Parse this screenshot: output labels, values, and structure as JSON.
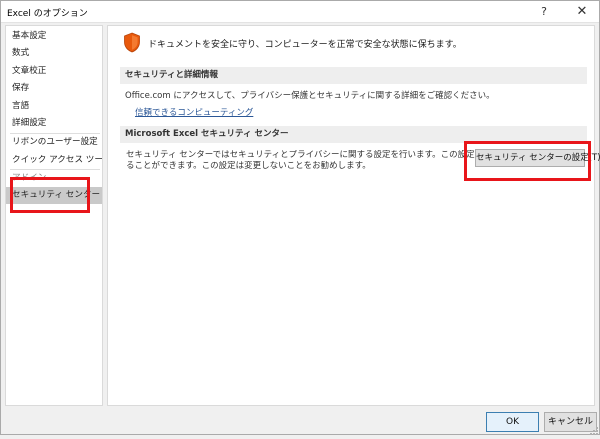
{
  "window": {
    "title": "Excel のオプション",
    "help_glyph": "?",
    "close_glyph": "✕"
  },
  "sidebar": {
    "items": [
      {
        "label": "基本設定"
      },
      {
        "label": "数式"
      },
      {
        "label": "文章校正"
      },
      {
        "label": "保存"
      },
      {
        "label": "言語"
      },
      {
        "label": "詳細設定"
      },
      {
        "label": "リボンのユーザー設定"
      },
      {
        "label": "クイック アクセス ツール バー"
      },
      {
        "label": "アドイン"
      },
      {
        "label": "セキュリティ センター",
        "selected": true
      }
    ]
  },
  "content": {
    "intro": "ドキュメントを安全に守り、コンピューターを正常で安全な状態に保ちます。",
    "privacy_section": {
      "heading": "セキュリティと詳細情報",
      "body": "Office.com にアクセスして、プライバシー保護とセキュリティに関する詳細をご確認ください。",
      "link": "信頼できるコンピューティング"
    },
    "trust_center_section": {
      "heading": "Microsoft Excel セキュリティ センター",
      "desc_line1": "セキュリティ センターではセキュリティとプライバシーに関する設定を行います。この設定により、コンピューターを保護す",
      "desc_line2": "ることができます。この設定は変更しないことをお勧めします。",
      "button": "セキュリティ センターの設定(T)..."
    }
  },
  "footer": {
    "ok": "OK",
    "cancel": "キャンセル"
  },
  "colors": {
    "highlight": "#e8151a",
    "shield": "#e8590c",
    "link": "#2b5797",
    "selected_nav": "#c9c9c9"
  },
  "icons": [
    "shield-icon",
    "help-icon",
    "close-icon",
    "resize-grip-icon"
  ]
}
